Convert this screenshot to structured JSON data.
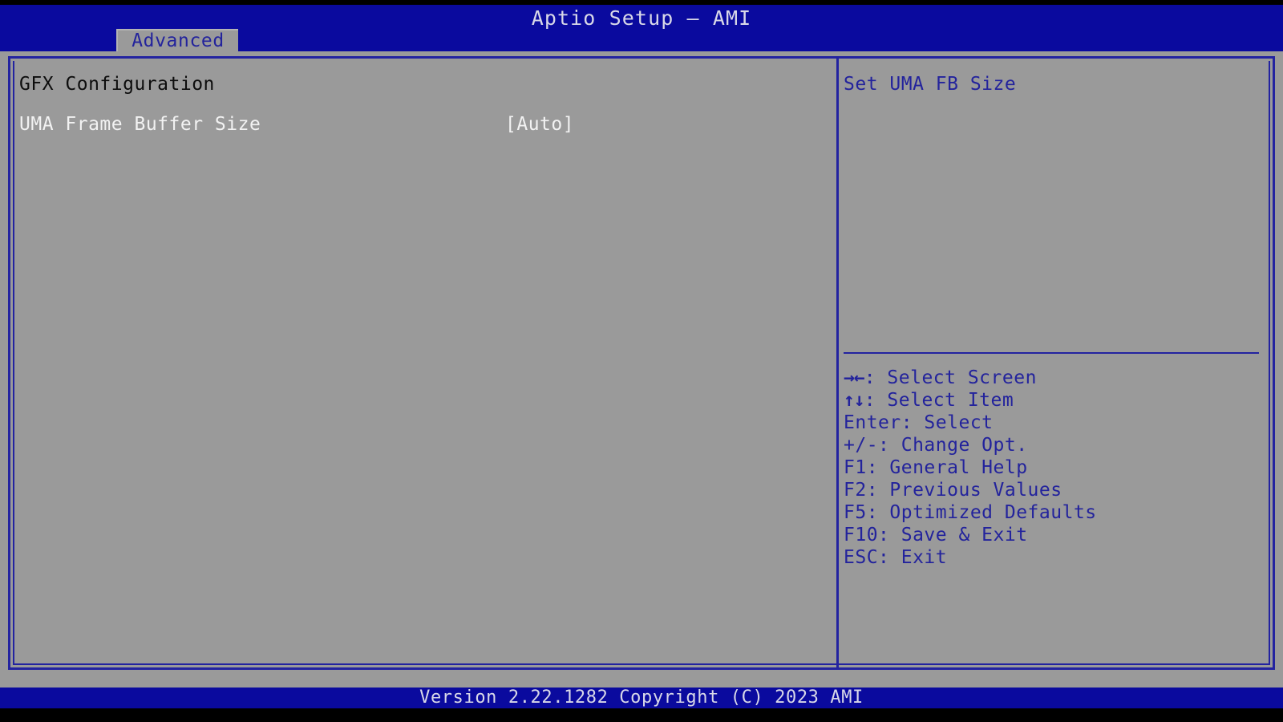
{
  "window": {
    "title": "Aptio Setup – AMI",
    "background_color": "#000000",
    "accent_blue": "#0a0a9e",
    "panel_gray": "#9a9a9a",
    "border_blue": "#2323a0",
    "text_white": "#f2f2f2",
    "text_black": "#0d0d0d",
    "text_blue": "#23239c"
  },
  "menubar": {
    "tabs": [
      {
        "label": "Advanced",
        "selected": true
      }
    ]
  },
  "main": {
    "section_title": "GFX Configuration",
    "items": [
      {
        "label": "UMA Frame Buffer Size",
        "value": "[Auto]",
        "selected": false
      }
    ]
  },
  "help": {
    "description": "Set UMA FB Size",
    "keys": [
      {
        "glyph": "→←",
        "text": ": Select Screen"
      },
      {
        "glyph": "↑↓",
        "text": ": Select Item"
      },
      {
        "glyph": "",
        "text": "Enter: Select"
      },
      {
        "glyph": "",
        "text": "+/-: Change Opt."
      },
      {
        "glyph": "",
        "text": "F1: General Help"
      },
      {
        "glyph": "",
        "text": "F2: Previous Values"
      },
      {
        "glyph": "",
        "text": "F5: Optimized Defaults"
      },
      {
        "glyph": "",
        "text": "F10: Save & Exit"
      },
      {
        "glyph": "",
        "text": "ESC: Exit"
      }
    ]
  },
  "footer": {
    "version_text": "Version 2.22.1282 Copyright (C) 2023 AMI"
  }
}
